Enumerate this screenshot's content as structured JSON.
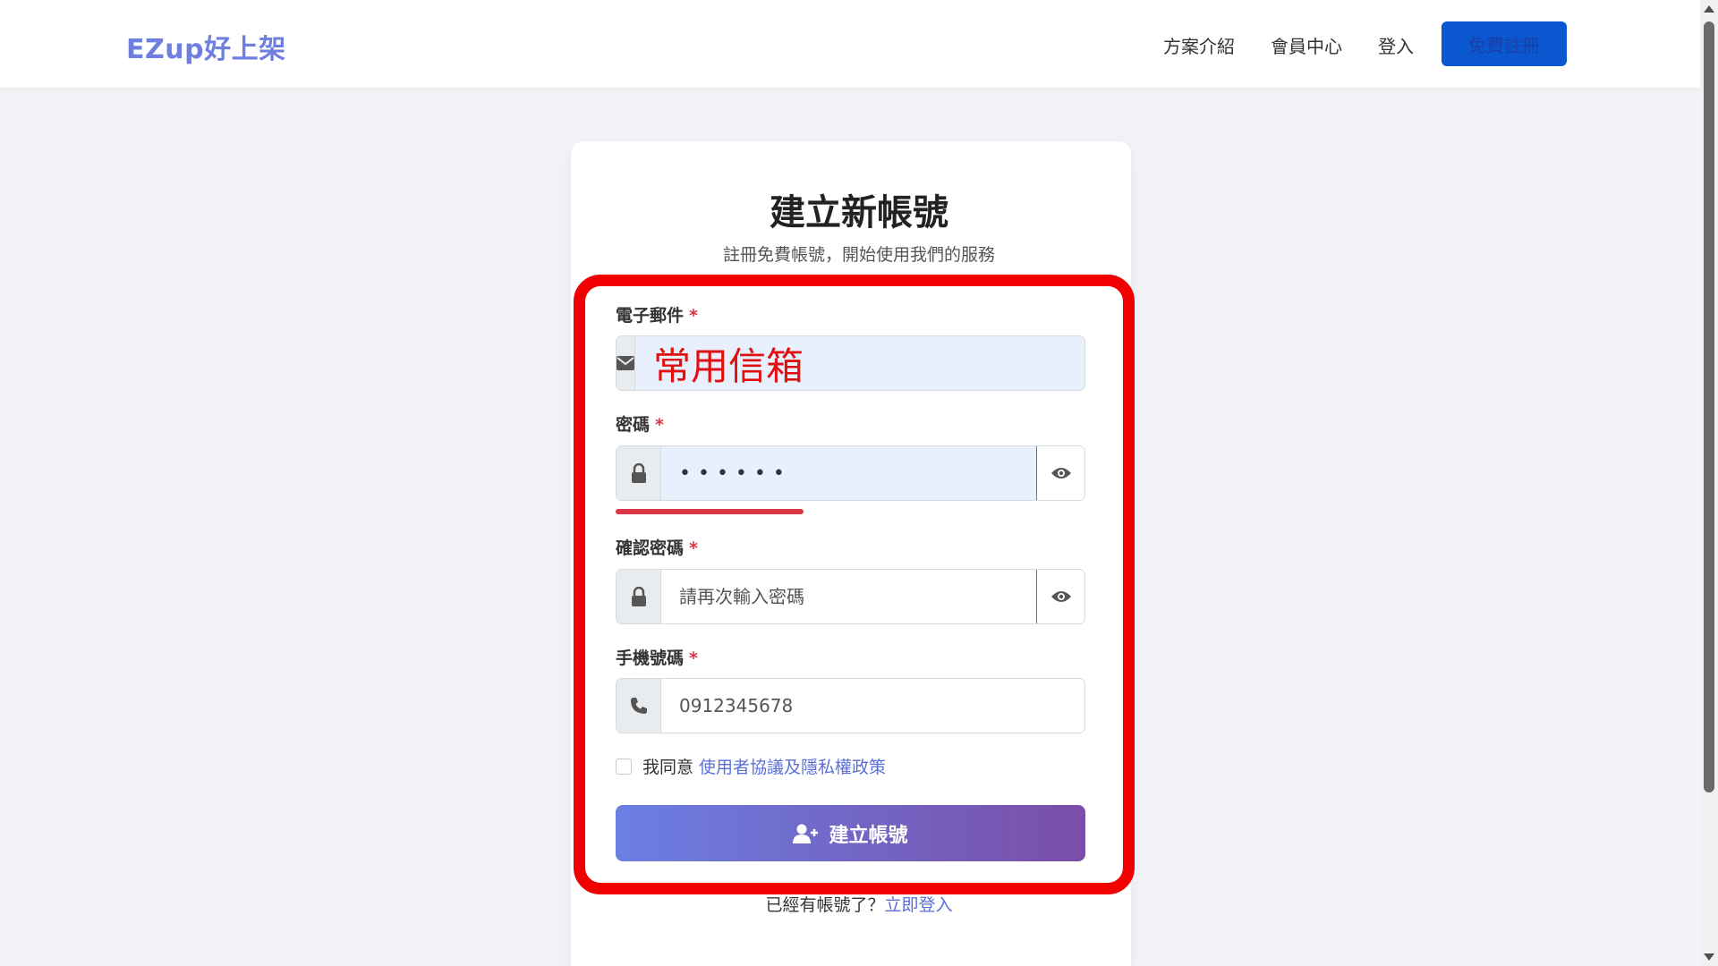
{
  "header": {
    "brand": "EZup好上架",
    "nav": {
      "plans": "方案介紹",
      "member": "會員中心",
      "login": "登入",
      "signup": "免費註冊"
    }
  },
  "card": {
    "title": "建立新帳號",
    "subtitle": "註冊免費帳號，開始使用我們的服務"
  },
  "form": {
    "email": {
      "label": "電子郵件",
      "required": "*",
      "value": "常用信箱",
      "icon": "envelope-icon"
    },
    "password": {
      "label": "密碼",
      "required": "*",
      "value": "••••••",
      "icon": "lock-icon",
      "toggle_icon": "eye-icon",
      "strength_color": "#dc3545"
    },
    "confirm_password": {
      "label": "確認密碼",
      "required": "*",
      "placeholder": "請再次輸入密碼",
      "icon": "lock-icon",
      "toggle_icon": "eye-icon"
    },
    "phone": {
      "label": "手機號碼",
      "required": "*",
      "placeholder": "0912345678",
      "icon": "phone-icon"
    },
    "terms": {
      "prefix": "我同意",
      "link": "使用者協議及隱私權政策",
      "checked": false
    },
    "submit": {
      "label": "建立帳號",
      "icon": "user-plus-icon"
    },
    "login_prompt": {
      "text": "已經有帳號了？",
      "link": "立即登入"
    }
  },
  "colors": {
    "brand": "#6f7fe0",
    "primary_button": "#0b57d0",
    "highlight": "#f00000",
    "gradient_start": "#6b7fe3",
    "gradient_end": "#7a4ea8",
    "link": "#5b6fd6"
  }
}
